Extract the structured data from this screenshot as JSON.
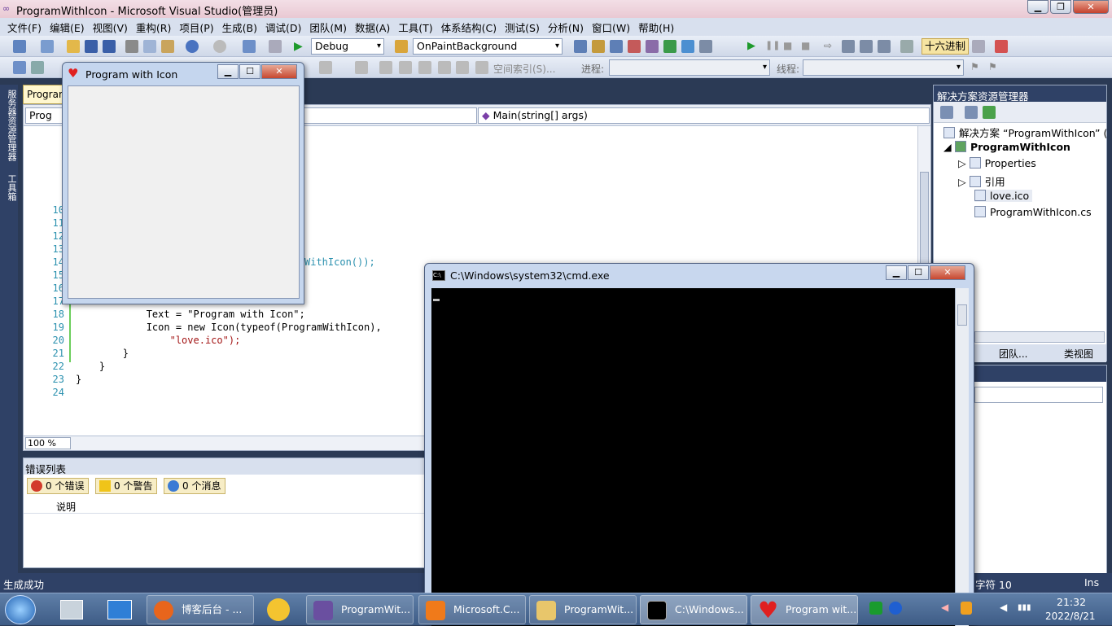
{
  "window": {
    "title": "ProgramWithIcon - Microsoft Visual Studio(管理员)"
  },
  "menu": [
    "文件(F)",
    "编辑(E)",
    "视图(V)",
    "重构(R)",
    "项目(P)",
    "生成(B)",
    "调试(D)",
    "团队(M)",
    "数据(A)",
    "工具(T)",
    "体系结构(C)",
    "测试(S)",
    "分析(N)",
    "窗口(W)",
    "帮助(H)"
  ],
  "toolbar1": {
    "config": "Debug",
    "method_combo": "OnPaintBackground",
    "hex_button": "十六进制"
  },
  "toolbar2": {
    "spatial_index": "空间索引(S)...",
    "process_label": "进程:",
    "thread_label": "线程:"
  },
  "left_strip": {
    "server_explorer": "服务器资源管理器",
    "toolbox": "工具箱"
  },
  "editor": {
    "tab": "Program",
    "nav_left": "Prog",
    "nav_right": "Main(string[] args)",
    "visible_code_fragment": "WithIcon());",
    "lines": [
      {
        "n": "18",
        "code": "            Text = \"Program with Icon\";"
      },
      {
        "n": "19",
        "code": "            Icon = new Icon(typeof(ProgramWithIcon),"
      },
      {
        "n": "20",
        "code": "                \"love.ico\");"
      },
      {
        "n": "21",
        "code": "        }"
      },
      {
        "n": "22",
        "code": "    }"
      },
      {
        "n": "23",
        "code": "}"
      },
      {
        "n": "24",
        "code": ""
      }
    ],
    "hidden_line_numbers": [
      "10",
      "11",
      "12",
      "13",
      "14",
      "15",
      "16",
      "17"
    ],
    "zoom": "100 %"
  },
  "error_list": {
    "title": "错误列表",
    "errors": "0 个错误",
    "warnings": "0 个警告",
    "messages": "0 个消息",
    "column": "说明"
  },
  "solution_explorer": {
    "title": "解决方案资源管理器",
    "solution": "解决方案 “ProgramWithIcon” (",
    "project": "ProgramWithIcon",
    "items": [
      "Properties",
      "引用",
      "love.ico",
      "ProgramWithIcon.cs"
    ],
    "tabs": [
      "团队...",
      "类视图"
    ]
  },
  "form_window": {
    "title": "Program with Icon"
  },
  "cmd_window": {
    "title": "C:\\Windows\\system32\\cmd.exe"
  },
  "status": {
    "left": "生成成功",
    "char": "字符 10",
    "mode": "Ins"
  },
  "taskbar": {
    "tasks": [
      "博客后台 - ...",
      "ProgramWit...",
      "Microsoft.C...",
      "ProgramWit...",
      "C:\\Windows...",
      "Program wit..."
    ],
    "time": "21:32",
    "date": "2022/8/21"
  }
}
